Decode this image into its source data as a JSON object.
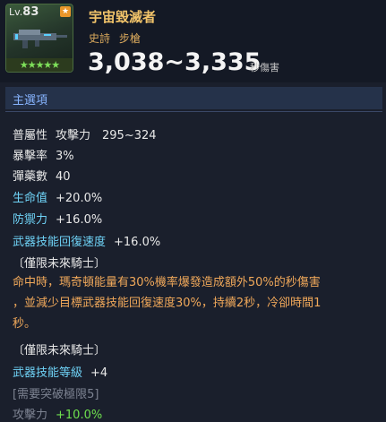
{
  "item": {
    "level_prefix": "Lv.",
    "level": "83",
    "stars": "★★★★★",
    "name": "宇宙毀滅者",
    "rarity": "史詩",
    "type": "步槍",
    "damage": "3,038~3,335",
    "damage_unit": "秒傷害"
  },
  "colors": {
    "title": "#f2c46a",
    "section_header": "#87b4ff",
    "cyan_stat": "#6fd3f7",
    "green_value": "#6ee04e",
    "orange_desc": "#f0a85a"
  },
  "main_options": {
    "header": "主選項",
    "stats": [
      {
        "label": "普屬性",
        "value": "攻擊力　295~324"
      },
      {
        "label": "暴擊率",
        "value": "3%"
      },
      {
        "label": "彈藥數",
        "value": "40"
      },
      {
        "label": "生命值",
        "value": "+20.0%"
      },
      {
        "label": "防禦力",
        "value": "+16.0%"
      },
      {
        "label": "武器技能回復速度",
        "value": "+16.0%"
      }
    ],
    "restriction_1": "〔僅限未來騎士〕",
    "effect_lines": [
      "命中時，瑪奇頓能量有30%機率爆發造成額外50%的秒傷害",
      "，並減少目標武器技能回復速度30%，持續2秒，冷卻時間1",
      "秒。"
    ],
    "restriction_2": "〔僅限未來騎士〕",
    "skill_stat": {
      "label": "武器技能等級",
      "value": "+4"
    },
    "breakthrough_note": "[需要突破極限5]",
    "partial_stat": {
      "label": "攻擊力",
      "value": "+10.0%"
    }
  }
}
